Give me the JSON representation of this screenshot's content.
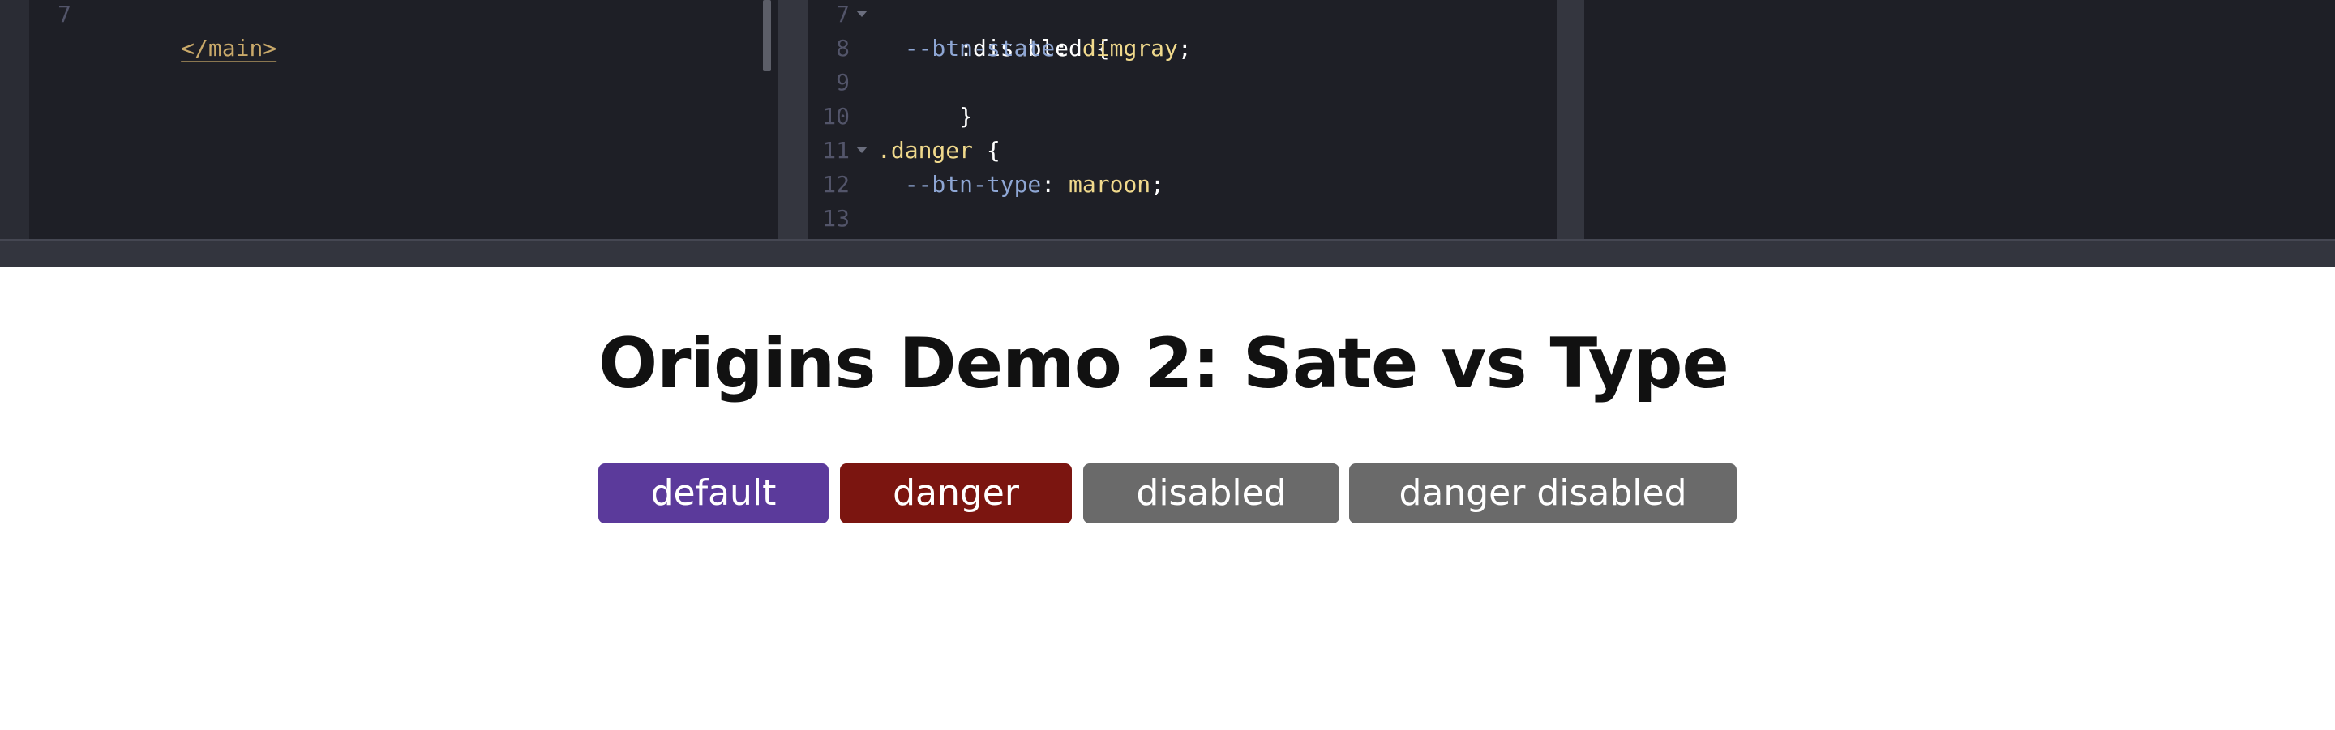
{
  "editor": {
    "html_pane": {
      "lines": [
        {
          "number": "7",
          "text": "</main>"
        }
      ]
    },
    "css_pane": {
      "lines": [
        {
          "number": "7",
          "text": ":disabled {"
        },
        {
          "number": "8",
          "prop": "--btn-state",
          "colon": ": ",
          "value": "dimgray",
          "end": ";"
        },
        {
          "number": "9",
          "text": "}"
        },
        {
          "number": "10",
          "text": ""
        },
        {
          "number": "11",
          "selector": ".danger",
          "rest": " {"
        },
        {
          "number": "12",
          "prop": "--btn-type",
          "colon": ": ",
          "value": "maroon",
          "end": ";"
        },
        {
          "number": "13",
          "text": "}"
        }
      ]
    }
  },
  "preview": {
    "title": "Origins Demo 2: Sate vs Type",
    "buttons": [
      {
        "label": "default",
        "color": "#5b3a9b"
      },
      {
        "label": "danger",
        "color": "#7b1510"
      },
      {
        "label": "disabled",
        "color": "#6a6a6a"
      },
      {
        "label": "danger disabled",
        "color": "#6a6a6a"
      }
    ]
  },
  "colors": {
    "editor_bg": "#1e1f26",
    "property": "#8ea6d4",
    "value": "#f0d98c",
    "tag": "#c9a96a"
  }
}
